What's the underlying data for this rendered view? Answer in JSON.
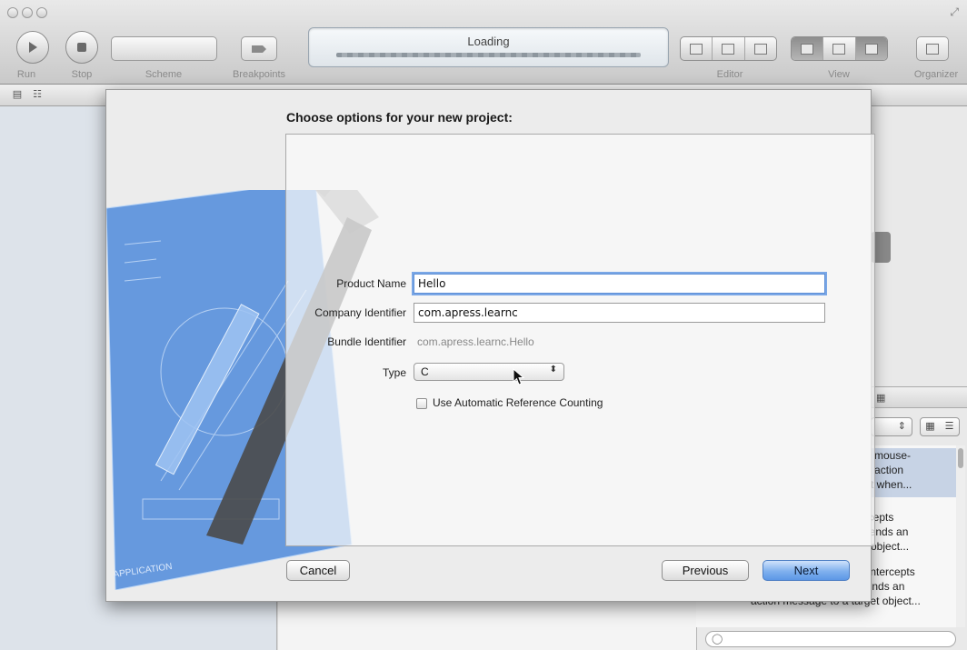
{
  "toolbar": {
    "run_label": "Run",
    "stop_label": "Stop",
    "scheme_label": "Scheme",
    "breakpoints_label": "Breakpoints",
    "activity_status": "Loading",
    "editor_label": "Editor",
    "view_label": "View",
    "organizer_label": "Organizer"
  },
  "dialog": {
    "title": "Choose options for your new project:",
    "product_name_label": "Product Name",
    "product_name_value": "Hello",
    "company_identifier_label": "Company Identifier",
    "company_identifier_value": "com.apress.learnc",
    "bundle_identifier_label": "Bundle Identifier",
    "bundle_identifier_value": "com.apress.learnc.Hello",
    "type_label": "Type",
    "type_value": "C",
    "arc_checkbox_label": "Use Automatic Reference Counting",
    "arc_checked": false,
    "cancel_label": "Cancel",
    "previous_label": "Previous",
    "next_label": "Next",
    "blueprint_text": "APPLICATION"
  },
  "library": {
    "items": [
      "epts mouse-",
      "s an action",
      "bject when...",
      "ntercepts",
      "nd sends an",
      "rget object...",
      "on - Intercepts",
      "nd sends an",
      "action message to a target object..."
    ]
  },
  "colors": {
    "accent": "#5c97e6",
    "blueprint": "#4f8bdc"
  }
}
